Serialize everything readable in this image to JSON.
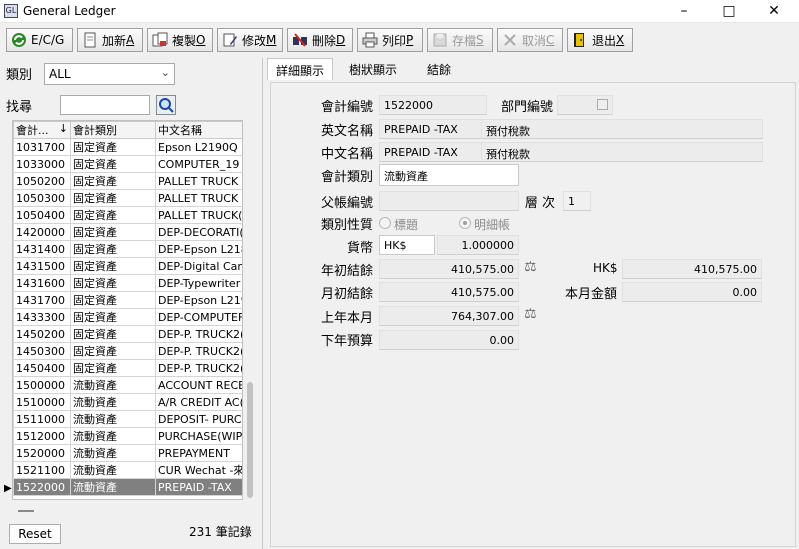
{
  "window": {
    "title": "General Ledger",
    "icon": "app-icon"
  },
  "toolbar": {
    "ecg": "E/C/G",
    "add": "加新",
    "add_key": "A",
    "copy": "複製",
    "copy_key": "O",
    "edit": "修改",
    "edit_key": "M",
    "delete": "刪除",
    "delete_key": "D",
    "print": "列印",
    "print_key": "P",
    "save": "存檔",
    "save_key": "S",
    "cancel": "取消",
    "cancel_key": "C",
    "exit": "退出",
    "exit_key": "X"
  },
  "filter": {
    "category_label": "類別",
    "category_value": "ALL",
    "search_label": "找尋",
    "search_value": ""
  },
  "grid": {
    "columns": [
      "會計...",
      "會計類別",
      "中文名稱"
    ],
    "rows": [
      [
        "1031700",
        "固定資產",
        "Epson L2190Q"
      ],
      [
        "1033000",
        "固定資產",
        "COMPUTER_19"
      ],
      [
        "1050200",
        "固定資產",
        "PALLET TRUCK"
      ],
      [
        "1050300",
        "固定資產",
        "PALLET TRUCK"
      ],
      [
        "1050400",
        "固定資產",
        "PALLET TRUCK("
      ],
      [
        "1420000",
        "固定資產",
        "DEP-DECORATI("
      ],
      [
        "1431400",
        "固定資產",
        "DEP-Epson L218"
      ],
      [
        "1431500",
        "固定資產",
        "DEP-Digital Came"
      ],
      [
        "1431600",
        "固定資產",
        "DEP-Typewriter"
      ],
      [
        "1431700",
        "固定資產",
        "DEP-Epson L219"
      ],
      [
        "1433300",
        "固定資產",
        "DEP-COMPUTEF"
      ],
      [
        "1450200",
        "固定資產",
        "DEP-P. TRUCK2("
      ],
      [
        "1450300",
        "固定資產",
        "DEP-P. TRUCK2("
      ],
      [
        "1450400",
        "固定資產",
        "DEP-P. TRUCK2("
      ],
      [
        "1500000",
        "流動資產",
        "ACCOUNT RECE"
      ],
      [
        "1510000",
        "流動資產",
        "A/R CREDIT AC("
      ],
      [
        "1511000",
        "流動資產",
        "DEPOSIT- PURC"
      ],
      [
        "1512000",
        "流動資產",
        "PURCHASE(WIP"
      ],
      [
        "1520000",
        "流動資產",
        "PREPAYMENT"
      ],
      [
        "1521100",
        "流動資產",
        "CUR Wechat -來"
      ],
      [
        "1522000",
        "流動資產",
        "PREPAID -TAX"
      ]
    ],
    "selected_index": 20,
    "record_count": "231 筆記錄",
    "reset": "Reset"
  },
  "tabs": [
    "詳細顯示",
    "樹狀顯示",
    "結餘"
  ],
  "form": {
    "account_no_label": "會計編號",
    "account_no": "1522000",
    "dept_label": "部門編號",
    "dept": "",
    "en_name_label": "英文名稱",
    "en_name": "PREPAID -TAX",
    "en_name_cn": "預付稅款",
    "cn_name_label": "中文名稱",
    "cn_name": "PREPAID -TAX",
    "cn_name_cn": "預付稅款",
    "category_label": "會計類別",
    "category": "流動資產",
    "parent_label": "父帳編號",
    "parent": "",
    "level_label": "層 次",
    "level": "1",
    "nature_label": "類別性質",
    "nature_title": "標題",
    "nature_detail": "明細帳",
    "currency_label": "貨幣",
    "currency": "HK$",
    "rate": "1.000000",
    "year_open_label": "年初結餘",
    "year_open": "410,575.00",
    "hk_label": "HK$",
    "hk_value": "410,575.00",
    "month_open_label": "月初結餘",
    "month_open": "410,575.00",
    "month_amount_label": "本月金額",
    "month_amount": "0.00",
    "last_year_label": "上年本月",
    "last_year": "764,307.00",
    "next_budget_label": "下年預算",
    "next_budget": "0.00"
  }
}
